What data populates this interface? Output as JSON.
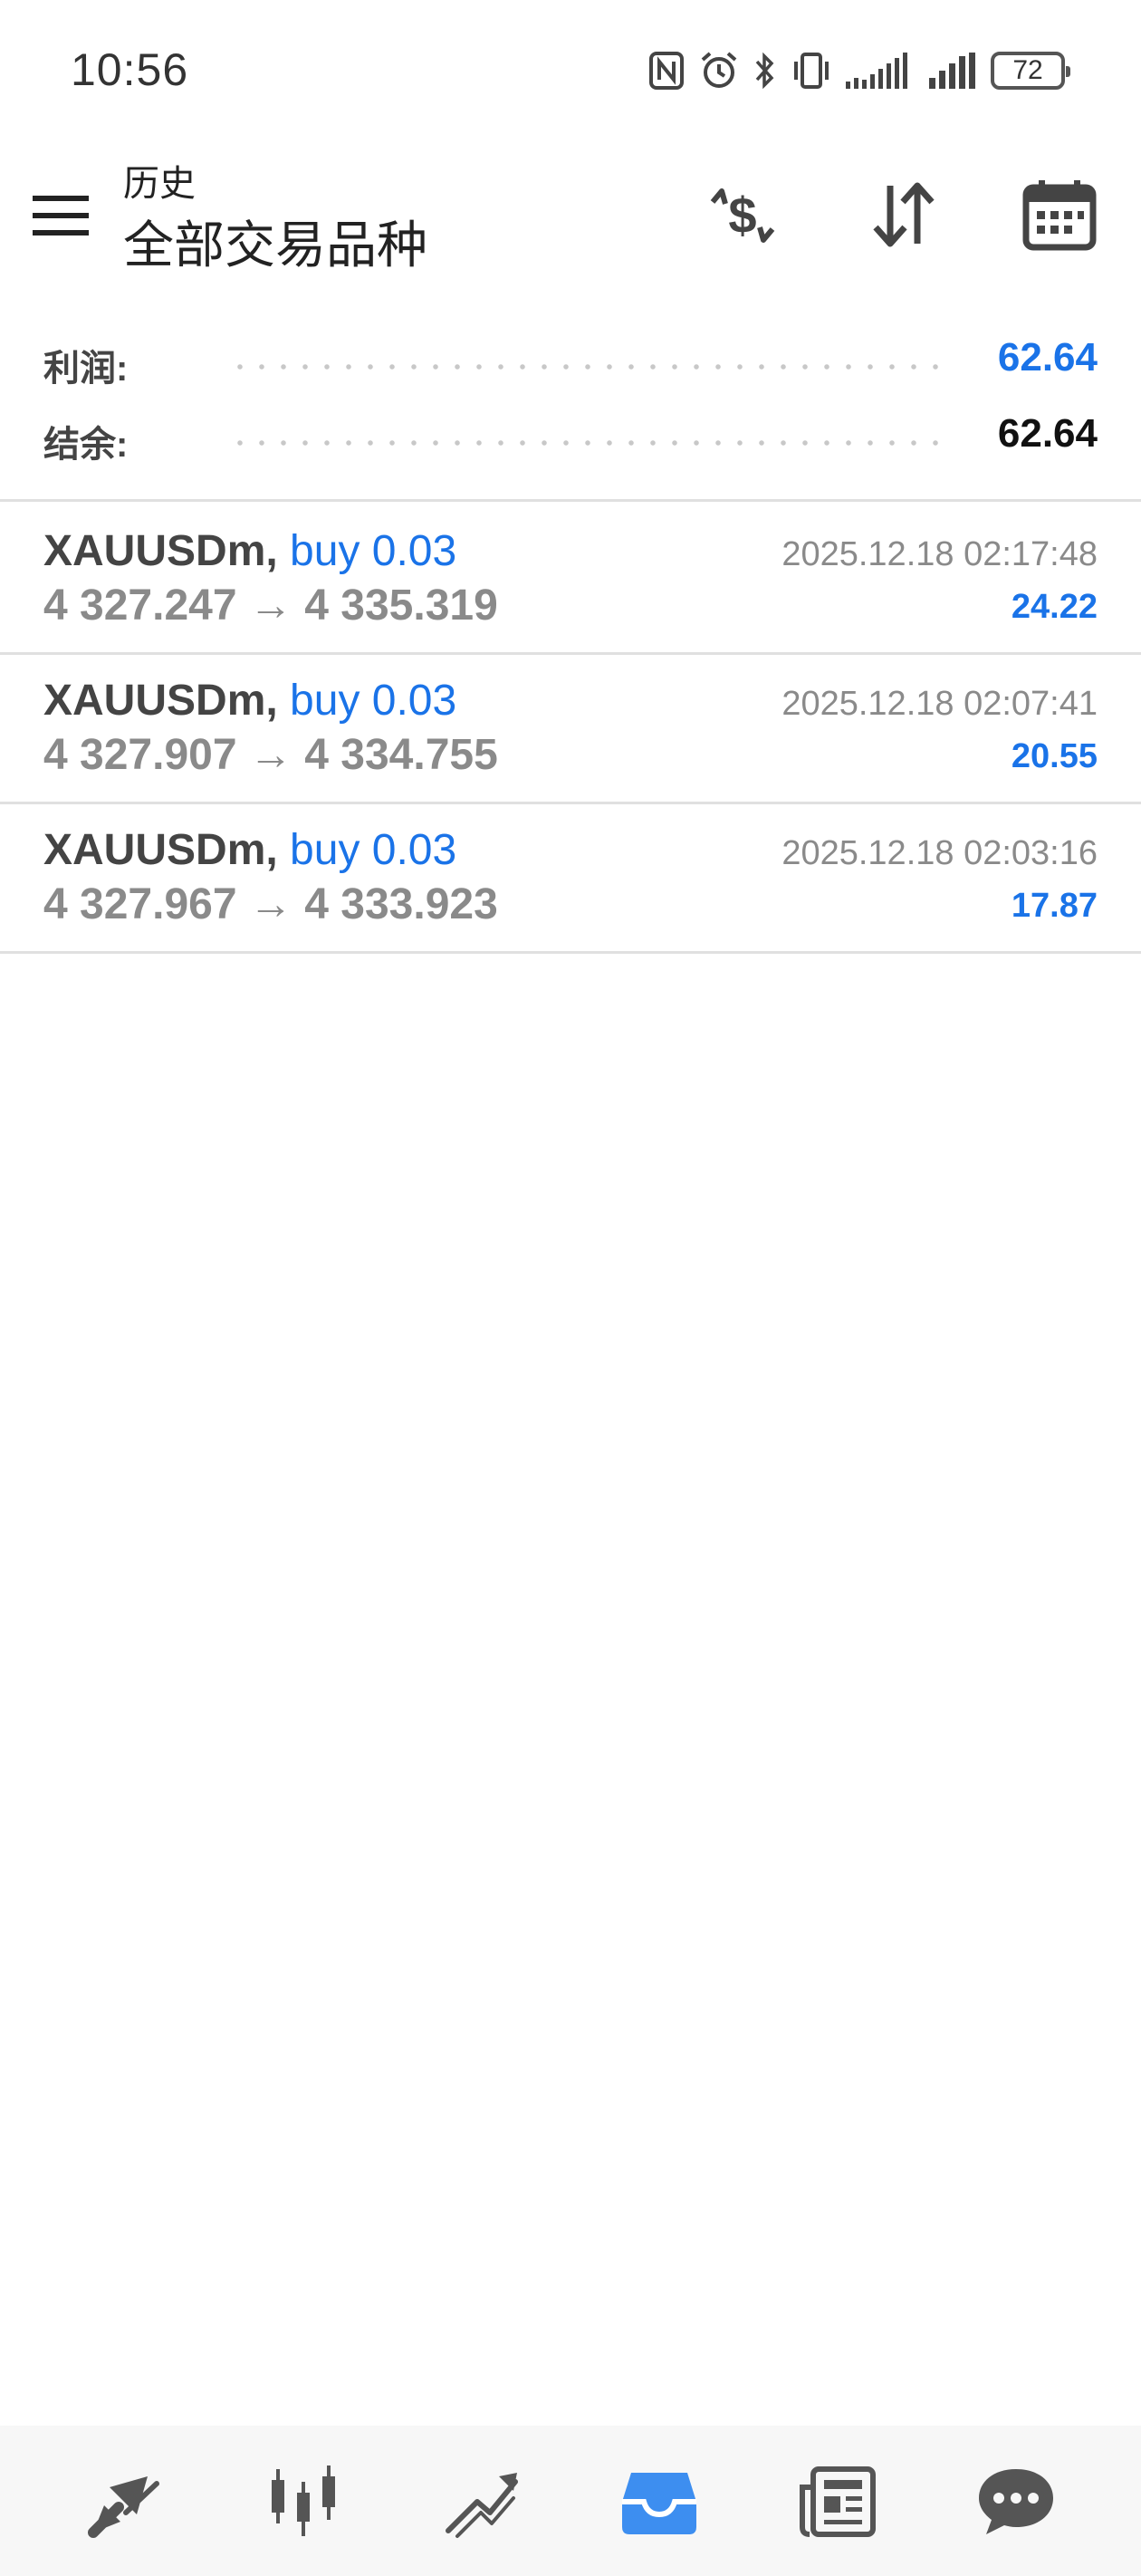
{
  "status_bar": {
    "time": "10:56",
    "battery": "72",
    "icons": [
      "nfc-icon",
      "alarm-icon",
      "bluetooth-icon",
      "vibrate-icon",
      "signal-icon",
      "signal-icon",
      "battery-icon"
    ]
  },
  "header": {
    "subtitle": "历史",
    "title": "全部交易品种",
    "actions": [
      "deposit-withdraw-icon",
      "sort-icon",
      "calendar-icon"
    ]
  },
  "summary": {
    "profit_label": "利润:",
    "profit_value": "62.64",
    "balance_label": "结余:",
    "balance_value": "62.64"
  },
  "trades": [
    {
      "symbol": "XAUUSDm,",
      "side": "buy 0.03",
      "open_price": "4 327.247",
      "arrow": "→",
      "close_price": "4 335.319",
      "time": "2025.12.18 02:17:48",
      "profit": "24.22"
    },
    {
      "symbol": "XAUUSDm,",
      "side": "buy 0.03",
      "open_price": "4 327.907",
      "arrow": "→",
      "close_price": "4 334.755",
      "time": "2025.12.18 02:07:41",
      "profit": "20.55"
    },
    {
      "symbol": "XAUUSDm,",
      "side": "buy 0.03",
      "open_price": "4 327.967",
      "arrow": "→",
      "close_price": "4 333.923",
      "time": "2025.12.18 02:03:16",
      "profit": "17.87"
    }
  ],
  "bottom_nav": {
    "items": [
      "quotes-icon",
      "chart-icon",
      "trade-icon",
      "history-icon",
      "news-icon",
      "messages-icon"
    ],
    "active": "history-icon"
  },
  "colors": {
    "accent": "#1a73e8",
    "text": "#444444",
    "muted": "#8a8a8a"
  }
}
